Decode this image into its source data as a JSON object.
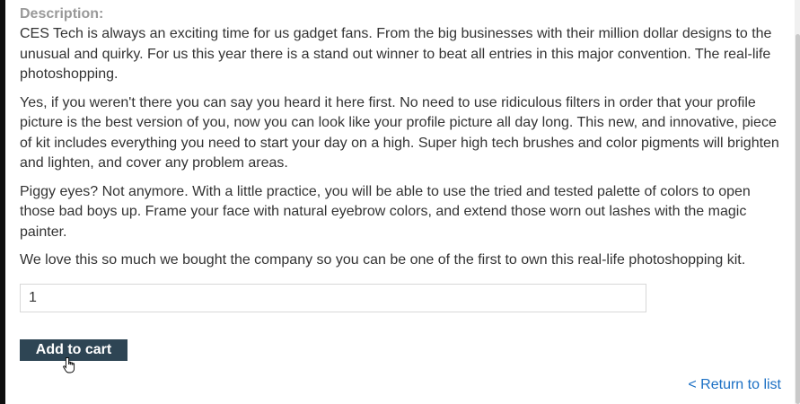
{
  "description": {
    "label": "Description:",
    "paragraphs": [
      "CES Tech is always an exciting time for us gadget fans. From the big businesses with their million dollar designs to the unusual and quirky. For us this year there is a stand out winner to beat all entries in this major convention. The real-life photoshopping.",
      "Yes, if you weren't there you can say you heard it here first. No need to use ridiculous filters in order that your profile picture is the best version of you, now you can look like your profile picture all day long. This new, and innovative, piece of kit includes everything you need to start your day on a high. Super high tech brushes and color pigments will brighten and lighten, and cover any problem areas.",
      "Piggy eyes? Not anymore. With a little practice, you will be able to use the tried and tested palette of colors to open those bad boys up. Frame your face with natural eyebrow colors, and extend those worn out lashes with the magic painter.",
      "We love this so much we bought the company so you can be one of the first to own this real-life photoshopping kit."
    ]
  },
  "quantity": {
    "value": "1"
  },
  "cart": {
    "add_label": "Add to cart"
  },
  "nav": {
    "return_label": "< Return to list"
  },
  "colors": {
    "button_bg": "#2e4554",
    "link": "#1a6fc4",
    "label": "#999999",
    "text": "#333333"
  },
  "icons": {
    "cursor": "hand-pointer-icon"
  }
}
